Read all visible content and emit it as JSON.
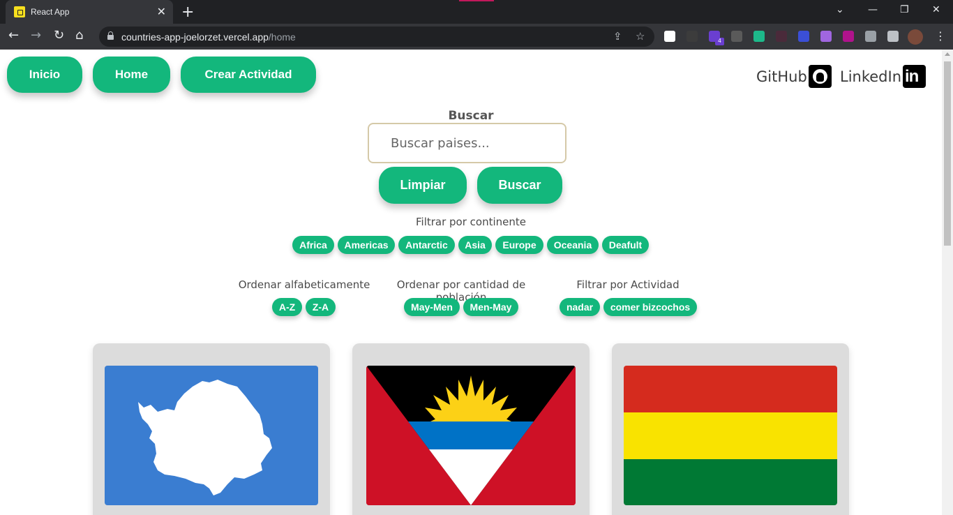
{
  "browser": {
    "tab_title": "React App",
    "url_host": "countries-app-joelorzet.vercel.app",
    "url_path": "/home",
    "ext_badge": "4"
  },
  "nav": {
    "inicio": "Inicio",
    "home": "Home",
    "crear": "Crear Actividad"
  },
  "social": {
    "github": "GitHub",
    "linkedin": "LinkedIn",
    "linkedin_logo": "in"
  },
  "search": {
    "label": "Buscar",
    "placeholder": "Buscar paises...",
    "clear": "Limpiar",
    "submit": "Buscar"
  },
  "filters": {
    "continent_title": "Filtrar por continente",
    "continents": [
      "Africa",
      "Americas",
      "Antarctic",
      "Asia",
      "Europe",
      "Oceania",
      "Deafult"
    ],
    "alpha_title": "Ordenar alfabeticamente",
    "alpha": [
      "A-Z",
      "Z-A"
    ],
    "population_title": "Ordenar por cantidad de población",
    "population": [
      "May-Men",
      "Men-May"
    ],
    "activity_title": "Filtrar por Actividad",
    "activities": [
      "nadar",
      "comer bizcochos"
    ]
  },
  "colors": {
    "accent": "#13b77c",
    "card_bg": "#dcdcdc"
  },
  "cards": [
    {
      "flag": "antarctica-flag"
    },
    {
      "flag": "antigua-and-barbuda-flag"
    },
    {
      "flag": "bolivia-flag"
    }
  ]
}
